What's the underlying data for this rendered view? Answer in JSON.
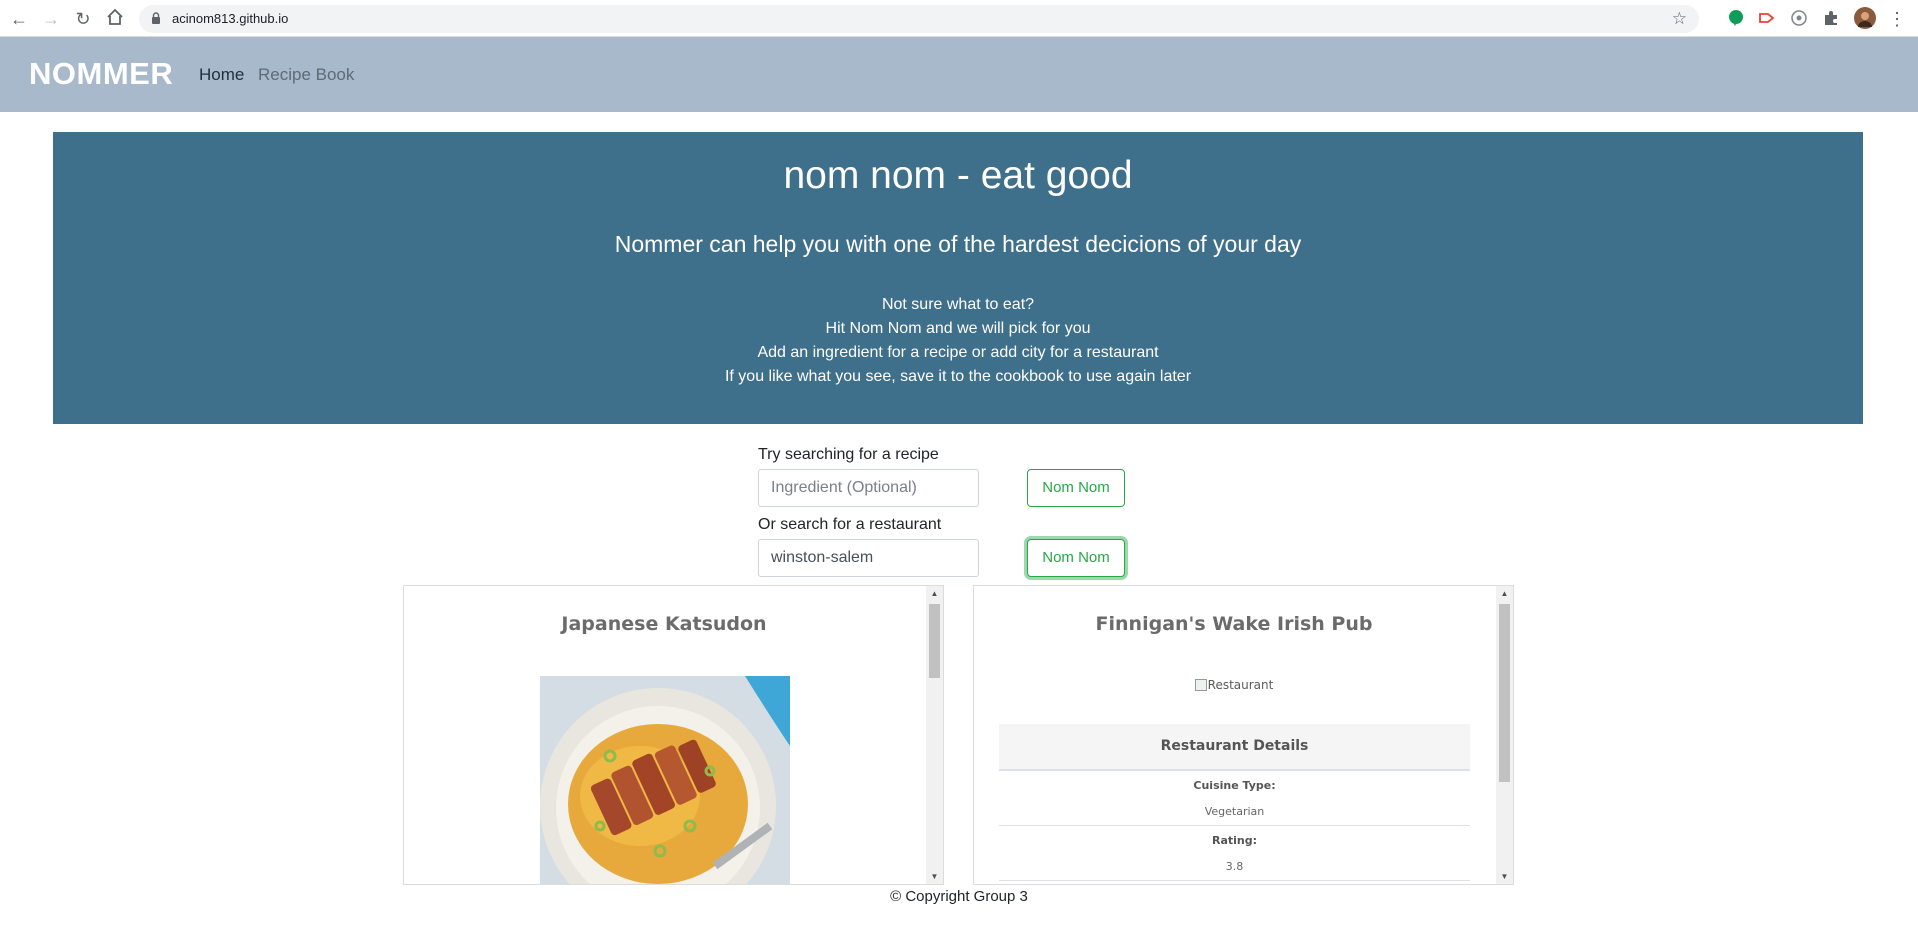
{
  "browser": {
    "url": "acinom813.github.io"
  },
  "navbar": {
    "brand": "NOMMER",
    "links": [
      "Home",
      "Recipe Book"
    ]
  },
  "hero": {
    "title": "nom nom - eat good",
    "subtitle": "Nommer can help you with one of the hardest decicions of your day",
    "lines": [
      "Not sure what to eat?",
      "Hit Nom Nom and we will pick for you",
      "Add an ingredient for a recipe or add city for a restaurant",
      "If you like what you see, save it to the cookbook to use again later"
    ]
  },
  "search": {
    "recipe_label": "Try searching for a recipe",
    "recipe_placeholder": "Ingredient (Optional)",
    "recipe_value": "",
    "recipe_button": "Nom Nom",
    "restaurant_label": "Or search for a restaurant",
    "restaurant_value": "winston-salem",
    "restaurant_button": "Nom Nom"
  },
  "recipe_card": {
    "title": "Japanese Katsudon"
  },
  "restaurant_card": {
    "title": "Finnigan's Wake Irish Pub",
    "image_alt": "Restaurant",
    "details_heading": "Restaurant Details",
    "details": [
      {
        "label": "Cuisine Type:",
        "value": "Vegetarian"
      },
      {
        "label": "Rating:",
        "value": "3.8"
      }
    ]
  },
  "footer": {
    "copyright": "© Copyright Group 3"
  }
}
